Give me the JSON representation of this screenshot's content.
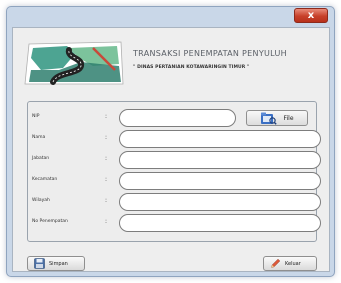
{
  "window": {
    "close_label": "x"
  },
  "header": {
    "title": "TRANSAKSI PENEMPATAN PENYULUH",
    "subtitle": "\" DINAS PERTANIAN KOTAWARINGIN TIMUR \""
  },
  "form": {
    "fields": [
      {
        "label": "NIP",
        "value": ""
      },
      {
        "label": "Nama",
        "value": ""
      },
      {
        "label": "Jabatan",
        "value": ""
      },
      {
        "label": "Kecamatan",
        "value": ""
      },
      {
        "label": "Wilayah",
        "value": ""
      },
      {
        "label": "No Penempatan",
        "value": ""
      }
    ],
    "colon": ":",
    "file_button_label": "File"
  },
  "buttons": {
    "save_label": "Simpan",
    "exit_label": "Keluar"
  },
  "colors": {
    "window_frame": "#c9d7e8",
    "close_button": "#c7402a",
    "panel": "#eeeeee"
  },
  "icons": {
    "logo": "map-logo-icon",
    "file": "folder-search-icon",
    "save": "save-icon",
    "exit": "pencil-icon"
  }
}
